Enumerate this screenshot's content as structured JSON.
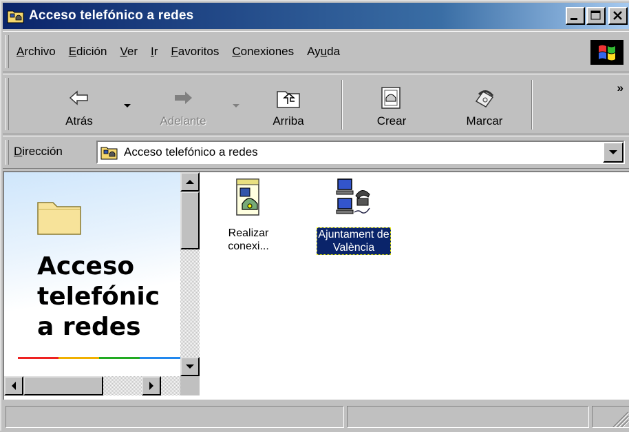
{
  "window": {
    "title": "Acceso telefónico a redes",
    "controls": {
      "minimize": "_",
      "maximize": "□",
      "close": "×"
    }
  },
  "menu": {
    "items": [
      {
        "pre": "",
        "u": "A",
        "post": "rchivo"
      },
      {
        "pre": "",
        "u": "E",
        "post": "dición"
      },
      {
        "pre": "",
        "u": "V",
        "post": "er"
      },
      {
        "pre": "",
        "u": "I",
        "post": "r"
      },
      {
        "pre": "",
        "u": "F",
        "post": "avoritos"
      },
      {
        "pre": "",
        "u": "C",
        "post": "onexiones"
      },
      {
        "pre": "Ay",
        "u": "u",
        "post": "da"
      }
    ]
  },
  "toolbar": {
    "back": "Atrás",
    "forward": "Adelante",
    "up": "Arriba",
    "create": "Crear",
    "dial": "Marcar",
    "more": "»"
  },
  "address": {
    "label_u": "D",
    "label_rest": "irección",
    "value": "Acceso telefónico a redes"
  },
  "leftpane": {
    "title_line1": "Acceso",
    "title_line2": "telefónic",
    "title_line3": "a redes"
  },
  "items": [
    {
      "line1": "Realizar",
      "line2": "conexi...",
      "selected": false,
      "icon": "make-connection-icon"
    },
    {
      "line1": "Ajuntament de",
      "line2": "València",
      "selected": true,
      "icon": "dialup-connection-icon"
    }
  ],
  "colors": {
    "titlebar_start": "#0a246a",
    "titlebar_end": "#a6caf0",
    "selection": "#0a246a",
    "face": "#c0c0c0"
  }
}
